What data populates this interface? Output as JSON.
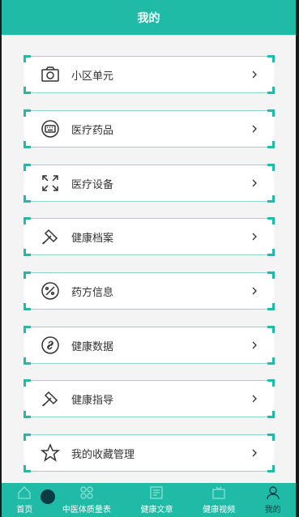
{
  "header": {
    "title": "我的"
  },
  "menu": {
    "items": [
      {
        "label": "小区单元",
        "icon": "camera-icon"
      },
      {
        "label": "医疗药品",
        "icon": "keyboard-icon"
      },
      {
        "label": "医疗设备",
        "icon": "expand-icon"
      },
      {
        "label": "健康档案",
        "icon": "brush-icon"
      },
      {
        "label": "药方信息",
        "icon": "palette-icon"
      },
      {
        "label": "健康数据",
        "icon": "link-icon"
      },
      {
        "label": "健康指导",
        "icon": "brush-icon"
      },
      {
        "label": "我的收藏管理",
        "icon": "star-icon"
      }
    ]
  },
  "tabbar": {
    "tabs": [
      {
        "label": "首页",
        "icon": "home-icon"
      },
      {
        "label": "中医体质量表",
        "icon": "grid-icon"
      },
      {
        "label": "健康文章",
        "icon": "article-icon"
      },
      {
        "label": "健康视频",
        "icon": "video-icon"
      },
      {
        "label": "我的",
        "icon": "user-icon"
      }
    ]
  },
  "colors": {
    "accent": "#1fbba6",
    "border": "#8fd6cc",
    "text": "#333333"
  }
}
